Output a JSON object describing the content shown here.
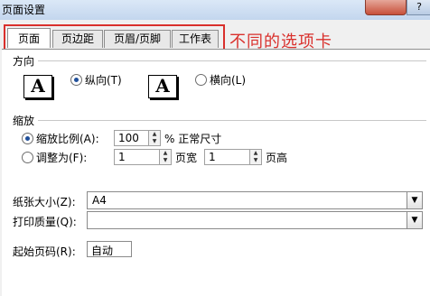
{
  "window": {
    "title": "页面设置",
    "help_label": "?"
  },
  "tabs": [
    {
      "label": "页面",
      "active": true
    },
    {
      "label": "页边距",
      "active": false
    },
    {
      "label": "页眉/页脚",
      "active": false
    },
    {
      "label": "工作表",
      "active": false
    }
  ],
  "annotation": {
    "text": "不同的选项卡",
    "color": "#d9302c"
  },
  "orientation": {
    "heading": "方向",
    "portrait_label": "纵向(T)",
    "landscape_label": "横向(L)",
    "selected": "portrait",
    "icon_letter": "A"
  },
  "scaling": {
    "heading": "缩放",
    "adjust_label": "缩放比例(A):",
    "adjust_value": "100",
    "percent_suffix": "% 正常尺寸",
    "fit_label": "调整为(F):",
    "pages_wide_value": "1",
    "pages_wide_suffix": "页宽",
    "pages_tall_value": "1",
    "pages_tall_suffix": "页高",
    "selected": "adjust"
  },
  "paper_size": {
    "label": "纸张大小(Z):",
    "value": "A4"
  },
  "print_quality": {
    "label": "打印质量(Q):",
    "value": ""
  },
  "first_page": {
    "label": "起始页码(R):",
    "value": "自动"
  }
}
